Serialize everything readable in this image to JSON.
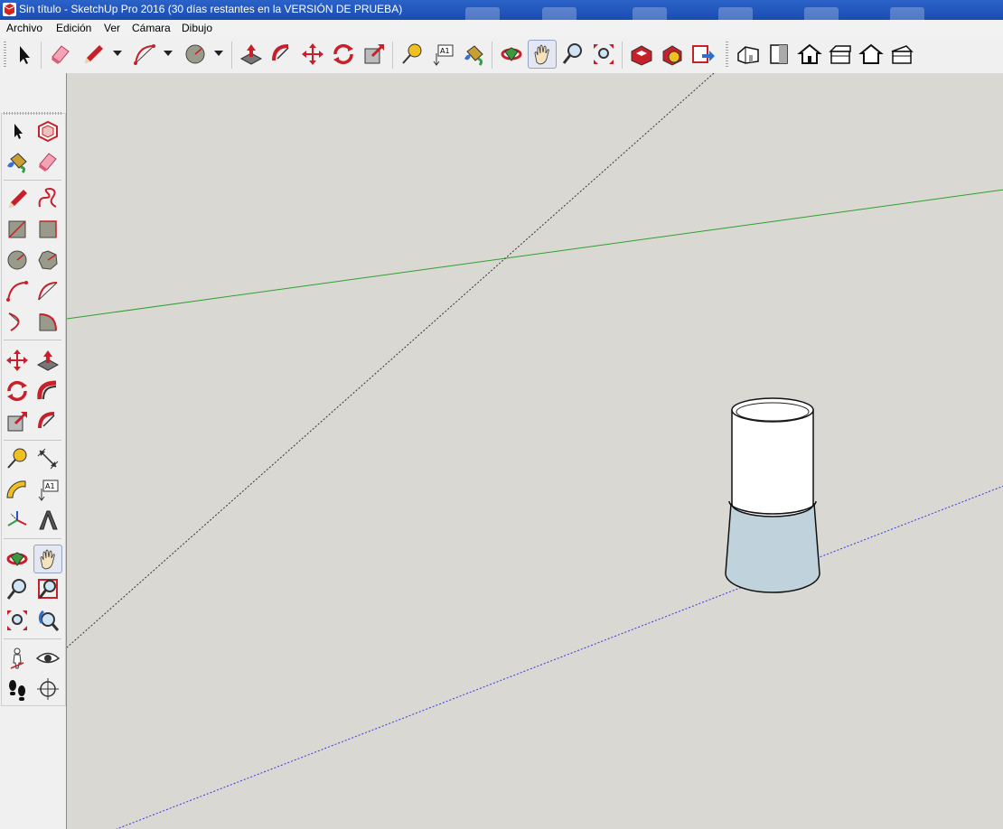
{
  "window": {
    "title": "Sin título - SketchUp Pro 2016 (30 días restantes en la VERSIÓN DE PRUEBA)",
    "app_icon": "sketchup-logo-icon"
  },
  "menu": {
    "items": [
      "Archivo",
      "Edición",
      "Ver",
      "Cámara",
      "Dibujo"
    ]
  },
  "toolbar": {
    "tools": [
      "select",
      "eraser",
      "line",
      "arc",
      "circle",
      "push-pull",
      "follow-me",
      "move",
      "rotate",
      "scale",
      "tape-measure",
      "text",
      "paint-bucket",
      "orbit",
      "pan",
      "zoom",
      "zoom-extents",
      "3d-warehouse",
      "extension-warehouse",
      "send-to-layout",
      "iso-view",
      "front-view",
      "top-view",
      "right-view",
      "back-view",
      "left-view"
    ],
    "active_tool": "pan"
  },
  "tool_palette": {
    "tools": [
      "select",
      "make-component",
      "paint-bucket",
      "eraser",
      "line",
      "freehand",
      "rectangle",
      "rotated-rectangle",
      "circle",
      "polygon",
      "arc",
      "two-point-arc",
      "three-point-arc",
      "pie",
      "move",
      "push-pull",
      "rotate",
      "follow-me",
      "scale",
      "offset",
      "tape-measure",
      "dimension",
      "protractor",
      "text",
      "axes",
      "3d-text",
      "orbit",
      "pan",
      "zoom",
      "zoom-window",
      "zoom-extents",
      "previous-view",
      "position-camera",
      "look-around",
      "walk",
      "section-plane"
    ],
    "active_tool": "pan"
  },
  "scene": {
    "background": "#d9d8d3",
    "axis_colors": {
      "green": "#2fa02f",
      "blue": "#3a3ae0",
      "black": "#333333"
    },
    "object": "cylinder"
  }
}
